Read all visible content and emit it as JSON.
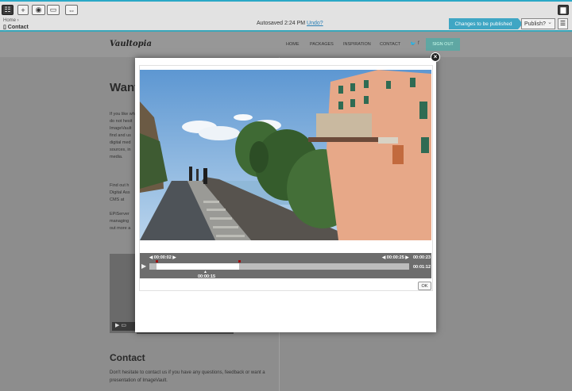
{
  "toolbar": {
    "breadcrumb": "Home",
    "page_name": "Contact",
    "autosaved": "Autosaved 2:24 PM",
    "undo": "Undo?",
    "changes_flag": "Changes to be published",
    "publish": "Publish?",
    "publish_chevron": "⌄",
    "menu_icon": "☰"
  },
  "site": {
    "logo": "Vaultopia",
    "nav": [
      "HOME",
      "PACKAGES",
      "INSPIRATION",
      "CONTACT"
    ],
    "signout": "SIGN OUT",
    "heading": "Want",
    "p1": [
      "If you like wh",
      "do not hesit",
      "ImageVault",
      "find and us",
      "digital med",
      "sources, in",
      "media."
    ],
    "p2": [
      "Find out h",
      "Digital Ass",
      "CMS at"
    ],
    "p3": [
      "EPiServer",
      "managing",
      "out more a"
    ],
    "contact_heading": "Contact",
    "contact_text": "Don't hesitate to contact us if you have any questions, feedback or want a presentation of ImageVault."
  },
  "modal": {
    "start_time": "00:00:02",
    "end_time": "00:00:25",
    "duration": "00:00:23",
    "total": "00:01:12",
    "position": "00:00:15",
    "ok": "OK",
    "close": "×"
  },
  "colors": {
    "accent": "#3fa6c4",
    "toolbar_border": "#39a7bb",
    "marker": "#a01010"
  }
}
